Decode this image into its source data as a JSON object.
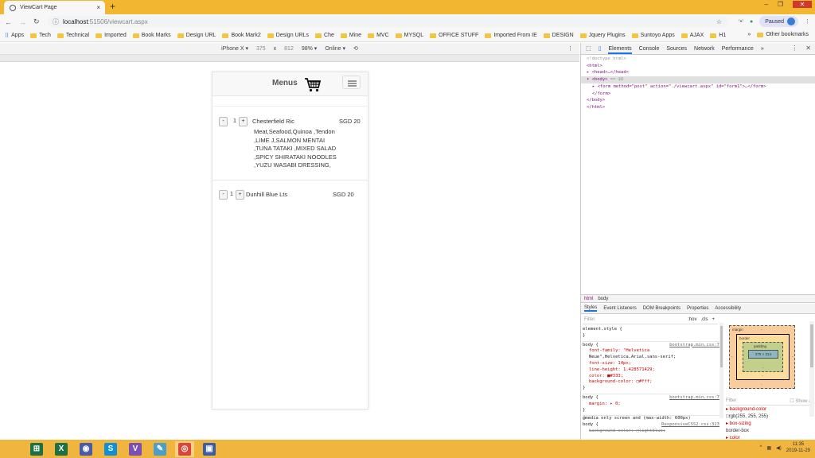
{
  "browser": {
    "tab_title": "ViewCart Page",
    "tab_close": "×",
    "new_tab": "+",
    "window_buttons": [
      "–",
      "❐",
      "✕"
    ],
    "url_host": "localhost",
    "url_rest": ":51506/viewcart.aspx",
    "profile_status": "Paused",
    "bookmarks": [
      {
        "label": "Apps",
        "type": "apps"
      },
      {
        "label": "Tech",
        "type": "folder"
      },
      {
        "label": "Technical",
        "type": "folder"
      },
      {
        "label": "Imported",
        "type": "folder"
      },
      {
        "label": "Book Marks",
        "type": "folder"
      },
      {
        "label": "Design URL",
        "type": "folder"
      },
      {
        "label": "Book Mark2",
        "type": "folder"
      },
      {
        "label": "Design URLs",
        "type": "folder"
      },
      {
        "label": "Che",
        "type": "folder"
      },
      {
        "label": "Mine",
        "type": "folder"
      },
      {
        "label": "MVC",
        "type": "folder"
      },
      {
        "label": "MYSQL",
        "type": "folder"
      },
      {
        "label": "OFFICE STUFF",
        "type": "folder"
      },
      {
        "label": "Imported From IE",
        "type": "folder"
      },
      {
        "label": "DESIGN",
        "type": "folder"
      },
      {
        "label": "Jquery Plugins",
        "type": "folder"
      },
      {
        "label": "Suntoyo Apps",
        "type": "folder"
      },
      {
        "label": "AJAX",
        "type": "folder"
      },
      {
        "label": "H1",
        "type": "folder"
      }
    ],
    "bookmarks_overflow": "»",
    "other_bookmarks": "Other bookmarks"
  },
  "device_toolbar": {
    "device": "iPhone X ▾",
    "width": "375",
    "times": "x",
    "height": "812",
    "zoom": "98% ▾",
    "network": "Online ▾"
  },
  "page": {
    "nav_title": "Menus",
    "cart_items": [
      {
        "minus": "-",
        "qty": "1",
        "plus": "+",
        "name": "Chesterfield Ric",
        "description": "Meat,Seafood,Quinoa ,Tendon ,LIME J,SALMON MENTAI ,TUNA TATAKI ,MIXED SALAD ,SPICY SHIRATAKI NOODLES ,YUZU WASABI DRESSING,",
        "price": "SGD 20"
      },
      {
        "minus": "-",
        "qty": "1",
        "plus": "+",
        "name": "Dunhill Blue Lts",
        "description": "",
        "price": "SGD 20"
      }
    ]
  },
  "devtools": {
    "tabs": [
      "Elements",
      "Console",
      "Sources",
      "Network",
      "Performance",
      "»"
    ],
    "active_tab": "Elements",
    "dom": {
      "doctype": "<!doctype html>",
      "html_open": "<html>",
      "head": "<head>…</head>",
      "body_open": "<body>",
      "body_marker": " == $0",
      "form_tag": "<form method=\"post\" action=\"./viewcart.aspx\" id=\"form1\">…</form>",
      "form_close": "</form>",
      "body_close": "</body>",
      "html_close": "</html>"
    },
    "breadcrumbs": [
      "html",
      "body"
    ],
    "style_tabs": [
      "Styles",
      "Event Listeners",
      "DOM Breakpoints",
      "Properties",
      "Accessibility"
    ],
    "filter_placeholder": "Filter",
    "hov": ":hov",
    "cls": ".cls",
    "add": "+",
    "styles": {
      "element_style": "element.style {",
      "close_brace": "}",
      "rule1_selector": "body {",
      "rule1_src": "bootstrap.min.css:7",
      "rule1_props": [
        "font-family: \"Helvetica",
        "   Neue\",Helvetica,Arial,sans-serif;",
        "font-size: 14px;",
        "line-height: 1.428571429;",
        "color: ■#333;",
        "background-color: □#fff;"
      ],
      "rule2_selector": "body {",
      "rule2_src": "bootstrap.min.css:7",
      "rule2_prop": "margin: ▸ 0;",
      "media": "@media only screen and (max-width: 600px)",
      "rule3_selector": "body {",
      "rule3_src": "ResponsiveCSS2.css:323",
      "rule3_prop": "background-color: □lightblue;"
    },
    "box_model": {
      "margin_label": "margin",
      "border_label": "border",
      "padding_label": "padding",
      "content": "375 × 314",
      "dash": "-"
    },
    "computed": {
      "filter": "Filter",
      "show_all": "Show all",
      "props": [
        "▸ background-color",
        "  □rgb(255, 255, 255)",
        "▸ box-sizing",
        "  border-box",
        "▸ color"
      ]
    }
  },
  "taskbar": {
    "apps": [
      {
        "name": "excel-green",
        "glyph": "⊞",
        "color": "#1e7145"
      },
      {
        "name": "excel",
        "glyph": "X",
        "color": "#1e7145"
      },
      {
        "name": "app-eyes",
        "glyph": "◉",
        "color": "#4a5aa8"
      },
      {
        "name": "skype",
        "glyph": "S",
        "color": "#0f8fd6"
      },
      {
        "name": "visual-studio",
        "glyph": "V",
        "color": "#7b4fb3"
      },
      {
        "name": "notes",
        "glyph": "✎",
        "color": "#4aa0c8"
      },
      {
        "name": "chrome",
        "glyph": "◎",
        "color": "#d8453a"
      },
      {
        "name": "sql",
        "glyph": "▣",
        "color": "#3b5ea8"
      }
    ],
    "time": "11:35",
    "date": "2019-11-29"
  }
}
